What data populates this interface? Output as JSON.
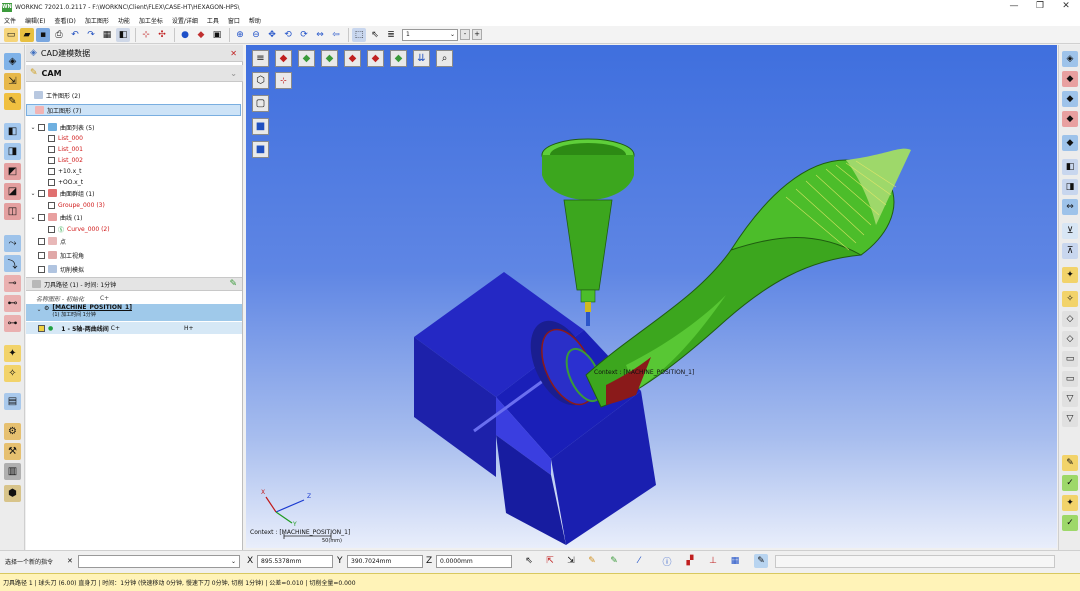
{
  "window": {
    "title": "WORKNC 72021.0.2117 - F:\\WORKNC\\Client\\FLEX\\CASE-HT\\HEXAGON-HPS\\",
    "logo_text": "WNC",
    "minimize": "—",
    "maximize": "❐",
    "close": "✕"
  },
  "menu": [
    "文件",
    "编辑(E)",
    "查看(D)",
    "加工图形",
    "功能",
    "加工坐标",
    "设置/详细",
    "工具",
    "窗口",
    "帮助"
  ],
  "toolbar": {
    "layer_value": "1",
    "minus": "-",
    "plus": "+"
  },
  "panel": {
    "cad_title": "CAD建模数据",
    "cad_close": "✕",
    "cam_title": "CAM",
    "tree": {
      "workpiece": "工件图形 (2)",
      "machining": "加工图形 (7)",
      "surface_list": "曲面列表 (5)",
      "list_000": "List_000",
      "list_001": "List_001",
      "list_002": "List_002",
      "item_10x": "+10.x_t",
      "item_oox": "+OO.x_t",
      "surface_group": "曲面群组 (1)",
      "groupe_000": "Groupe_000 (3)",
      "curves": "曲线 (1)",
      "curve_000": "Curve_000 (2)",
      "points": "点",
      "views": "加工视角",
      "simulation": "切削模拟"
    },
    "toolpath": {
      "header": "刀具路径 (1) - 时间: 1分钟",
      "default_row": "名称图形 - 初始化",
      "default_row_axis": "C+",
      "machine_position": "[MACHINE_POSITION_1]",
      "machine_sub": "(1) 加工时间 1分钟",
      "op_label": "1 - 5轴-两曲线间",
      "op_axis1": "C+",
      "op_axis2": "H+"
    }
  },
  "viewport": {
    "context_label_3d": "Context : [MACHINE_POSITION_1]",
    "context_label": "Context : [MACHINE_POSITION_1]",
    "scale_label": "50(mm)",
    "axis_x": "X",
    "axis_y": "Y",
    "axis_z": "Z",
    "colors": {
      "bg_top": "#3f6fde",
      "bg_bottom": "#e9eefb",
      "part_green": "#3ca61e",
      "block_blue": "#1a1fb8"
    }
  },
  "status": {
    "select_hint": "选择一个新的指令",
    "select_hint_close": "✕",
    "x_label": "X",
    "x_value": "895.5378mm",
    "y_label": "Y",
    "y_value": "390.7024mm",
    "z_label": "Z",
    "z_value": "0.0000mm"
  },
  "bottom_bar": "刀具路径 1 | 球头刀 (6.00) 直身刀 | 时间：1分钟 (快速移动 0分钟, 慢速下刀 0分钟, 切削 1分钟) | 公差=0.010 | 切削全量=0.000"
}
